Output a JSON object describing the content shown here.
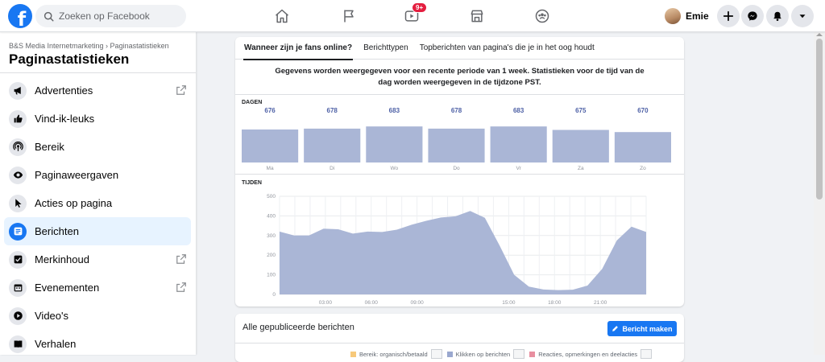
{
  "topbar": {
    "logo_letter": "f",
    "search_placeholder": "Zoeken op Facebook",
    "watch_badge": "9+",
    "profile_name": "Emie"
  },
  "sidebar": {
    "breadcrumb": "B&S Media Internetmarketing › Paginastatistieken",
    "title": "Paginastatistieken",
    "items": [
      {
        "label": "Advertenties",
        "icon": "megaphone-icon",
        "external": true
      },
      {
        "label": "Vind-ik-leuks",
        "icon": "thumbs-up-icon",
        "external": false
      },
      {
        "label": "Bereik",
        "icon": "broadcast-icon",
        "external": false
      },
      {
        "label": "Paginaweergaven",
        "icon": "eye-icon",
        "external": false
      },
      {
        "label": "Acties op pagina",
        "icon": "cursor-icon",
        "external": false
      },
      {
        "label": "Berichten",
        "icon": "post-icon",
        "external": false,
        "active": true
      },
      {
        "label": "Merkinhoud",
        "icon": "branded-content-icon",
        "external": true
      },
      {
        "label": "Evenementen",
        "icon": "calendar-icon",
        "external": true
      },
      {
        "label": "Video's",
        "icon": "play-icon",
        "external": false
      },
      {
        "label": "Verhalen",
        "icon": "book-icon",
        "external": false
      }
    ]
  },
  "tabs": [
    {
      "label": "Wanneer zijn je fans online?",
      "active": true
    },
    {
      "label": "Berichttypen",
      "active": false
    },
    {
      "label": "Topberichten van pagina's die je in het oog houdt",
      "active": false
    }
  ],
  "intro_text": "Gegevens worden weergegeven voor een recente periode van 1 week. Statistieken voor de tijd van de dag worden weergegeven in de tijdzone PST.",
  "days_label": "DAGEN",
  "times_label": "TIJDEN",
  "posts_card": {
    "title": "Alle gepubliceerde berichten",
    "create_button": "Bericht maken",
    "legend": [
      {
        "label": "Bereik: organisch/betaald",
        "color": "#f7c97a"
      },
      {
        "label": "Klikken op berichten",
        "color": "#9aa8cf"
      },
      {
        "label": "Reacties, opmerkingen en deelacties",
        "color": "#e88fa0"
      }
    ]
  },
  "colors": {
    "accent": "#1877f2",
    "chart_fill": "#aab6d6",
    "chart_label": "#4c5fa5"
  },
  "chart_data": [
    {
      "type": "bar",
      "title": "DAGEN",
      "categories": [
        "Ma",
        "Di",
        "Wo",
        "Do",
        "Vr",
        "Za",
        "Zo"
      ],
      "values": [
        676,
        678,
        683,
        678,
        683,
        675,
        670
      ],
      "data_labels": [
        "676",
        "678",
        "683",
        "678",
        "683",
        "675",
        "670"
      ]
    },
    {
      "type": "area",
      "title": "TIJDEN",
      "x": [
        0,
        1,
        2,
        3,
        4,
        5,
        6,
        7,
        8,
        9,
        10,
        11,
        12,
        13,
        14,
        15,
        16,
        17,
        18,
        19,
        20,
        21,
        22,
        23
      ],
      "values": [
        320,
        300,
        300,
        335,
        332,
        310,
        320,
        318,
        330,
        355,
        375,
        392,
        398,
        425,
        390,
        250,
        100,
        40,
        25,
        22,
        24,
        45,
        130,
        275,
        345,
        318
      ],
      "x_ticks": [
        "03:00",
        "06:00",
        "09:00",
        "15:00",
        "18:00",
        "21:00"
      ],
      "x_tick_hours": [
        3,
        6,
        9,
        15,
        18,
        21
      ],
      "y_ticks": [
        "0",
        "100",
        "200",
        "300",
        "400",
        "500"
      ],
      "ylim": [
        0,
        500
      ],
      "grid": true
    }
  ]
}
